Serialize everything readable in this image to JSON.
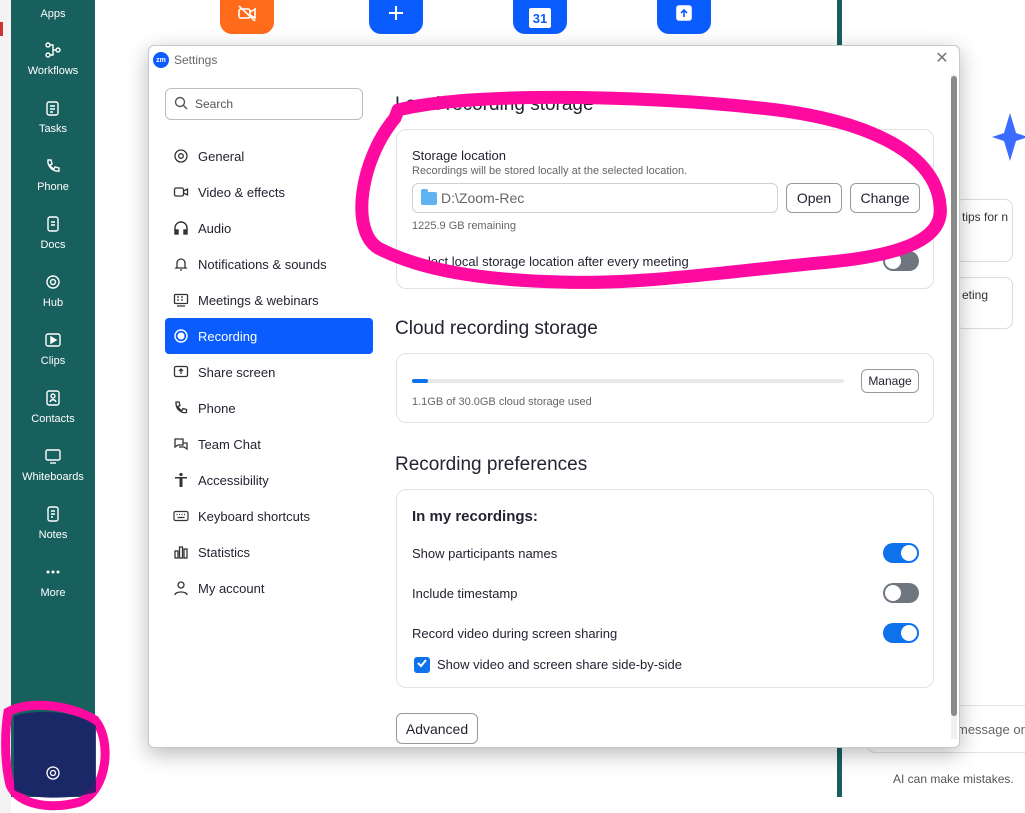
{
  "rail": {
    "items": [
      {
        "label": "Apps"
      },
      {
        "label": "Workflows"
      },
      {
        "label": "Tasks"
      },
      {
        "label": "Phone"
      },
      {
        "label": "Docs"
      },
      {
        "label": "Hub"
      },
      {
        "label": "Clips"
      },
      {
        "label": "Contacts"
      },
      {
        "label": "Whiteboards"
      },
      {
        "label": "Notes"
      },
      {
        "label": "More"
      }
    ],
    "settings_icon": "gear-icon"
  },
  "background": {
    "tiles": [
      {
        "icon": "video-off-icon",
        "color": "#ff6b1a"
      },
      {
        "icon": "plus-icon",
        "color": "#0b5cff"
      },
      {
        "icon": "calendar-icon",
        "label": "31",
        "color": "#0b5cff"
      },
      {
        "icon": "share-up-icon",
        "color": "#0b5cff"
      }
    ],
    "right_panel": {
      "card1_text": "tips for n",
      "card2_text": "eting",
      "input_placeholder": "message or",
      "footer": "AI can make mistakes."
    }
  },
  "dialog": {
    "title": "Settings",
    "logo": "zm",
    "search_placeholder": "Search",
    "nav": [
      {
        "label": "General",
        "icon": "gear-icon"
      },
      {
        "label": "Video & effects",
        "icon": "video-icon"
      },
      {
        "label": "Audio",
        "icon": "headphones-icon"
      },
      {
        "label": "Notifications & sounds",
        "icon": "bell-icon"
      },
      {
        "label": "Meetings & webinars",
        "icon": "meetings-icon"
      },
      {
        "label": "Recording",
        "icon": "record-icon",
        "active": true
      },
      {
        "label": "Share screen",
        "icon": "share-screen-icon"
      },
      {
        "label": "Phone",
        "icon": "phone-icon"
      },
      {
        "label": "Team Chat",
        "icon": "chat-icon"
      },
      {
        "label": "Accessibility",
        "icon": "accessibility-icon"
      },
      {
        "label": "Keyboard shortcuts",
        "icon": "keyboard-icon"
      },
      {
        "label": "Statistics",
        "icon": "statistics-icon"
      },
      {
        "label": "My account",
        "icon": "account-icon"
      }
    ],
    "local": {
      "heading": "Local recording storage",
      "storage_label": "Storage location",
      "storage_desc": "Recordings will be stored locally at the selected location.",
      "path": "D:\\Zoom-Rec",
      "open_label": "Open",
      "change_label": "Change",
      "remaining": "1225.9 GB remaining",
      "select_each_label": "Select local storage location after every meeting",
      "select_each_on": false
    },
    "cloud": {
      "heading": "Cloud recording storage",
      "manage_label": "Manage",
      "usage_text": "1.1GB of 30.0GB cloud storage used",
      "usage_fraction": 0.037
    },
    "prefs": {
      "heading": "Recording preferences",
      "subheading": "In my recordings:",
      "show_names_label": "Show participants names",
      "show_names_on": true,
      "timestamp_label": "Include timestamp",
      "timestamp_on": false,
      "record_video_label": "Record video during screen sharing",
      "record_video_on": true,
      "side_by_side_label": "Show video and screen share side-by-side",
      "side_by_side_checked": true,
      "advanced_label": "Advanced"
    }
  },
  "colors": {
    "rail": "#18605e",
    "accent": "#0b5cff",
    "annotation": "#ff0aa0"
  }
}
